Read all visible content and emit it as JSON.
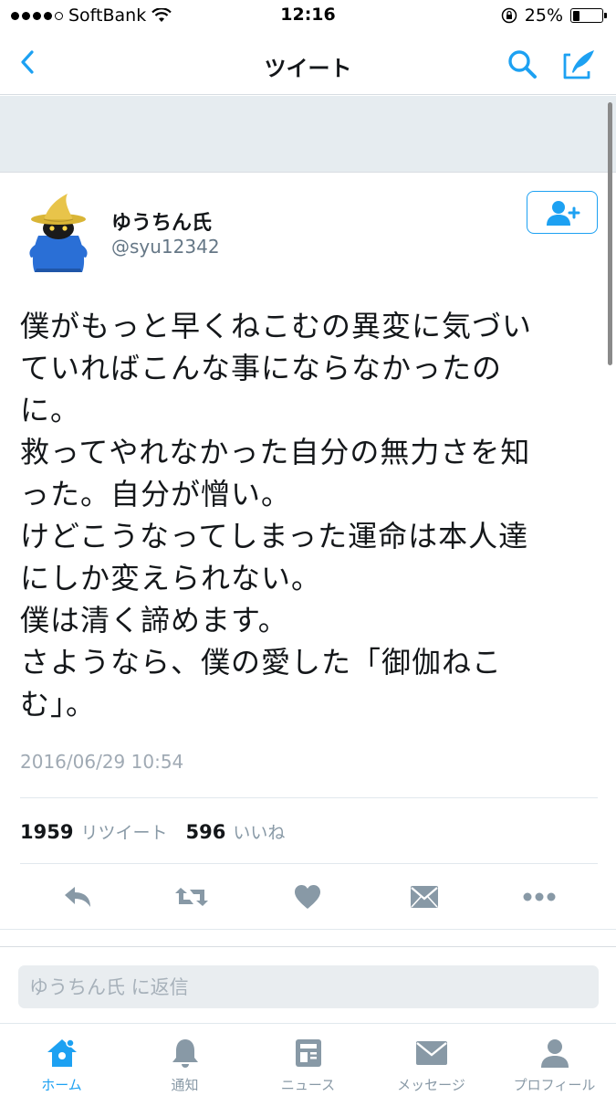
{
  "status_bar": {
    "carrier": "SoftBank",
    "time": "12:16",
    "battery": "25%",
    "battery_level": 0.25
  },
  "nav": {
    "title": "ツイート"
  },
  "tweet": {
    "author_name": "ゆうちん氏",
    "author_handle": "@syu12342",
    "text": "僕がもっと早くねこむの異変に気づい\nていればこんな事にならなかったの\nに。\n救ってやれなかった自分の無力さを知\nった。自分が憎い。\nけどこうなってしまった運命は本人達\nにしか変えられない。\n僕は清く諦めます。\nさようなら、僕の愛した「御伽ねこ\nむ」。",
    "timestamp": "2016/06/29 10:54",
    "retweet_count": "1959",
    "retweet_label": "リツイート",
    "like_count": "596",
    "like_label": "いいね"
  },
  "reply": {
    "placeholder": "ゆうちん氏 に返信"
  },
  "tabs": [
    {
      "label": "ホーム",
      "icon": "home-icon",
      "active": true
    },
    {
      "label": "通知",
      "icon": "bell-icon",
      "active": false
    },
    {
      "label": "ニュース",
      "icon": "news-icon",
      "active": false
    },
    {
      "label": "メッセージ",
      "icon": "envelope-icon",
      "active": false
    },
    {
      "label": "プロフィール",
      "icon": "profile-icon",
      "active": false
    }
  ],
  "colors": {
    "accent": "#1da1f2",
    "icon_gray": "#8899a6",
    "banner": "#e6ecf0"
  }
}
